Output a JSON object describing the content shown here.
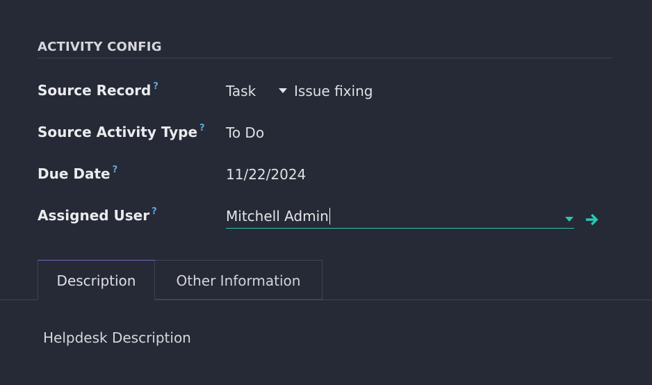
{
  "section": {
    "title": "ACTIVITY CONFIG"
  },
  "fields": {
    "source_record": {
      "label": "Source Record",
      "help": "?",
      "model": "Task",
      "record": "Issue fixing"
    },
    "source_activity_type": {
      "label": "Source Activity Type",
      "help": "?",
      "value": "To Do"
    },
    "due_date": {
      "label": "Due Date",
      "help": "?",
      "value": "11/22/2024"
    },
    "assigned_user": {
      "label": "Assigned User",
      "help": "?",
      "value": "Mitchell Admin",
      "link_icon": "arrow-right-icon"
    }
  },
  "tabs": [
    {
      "label": "Description",
      "active": true
    },
    {
      "label": "Other Information",
      "active": false
    }
  ],
  "tab_content": {
    "text": "Helpdesk Description"
  },
  "colors": {
    "background": "#262a36",
    "accent": "#2fc4b2",
    "help": "#5fa8d8",
    "active_tab_top": "#7c63b8"
  }
}
